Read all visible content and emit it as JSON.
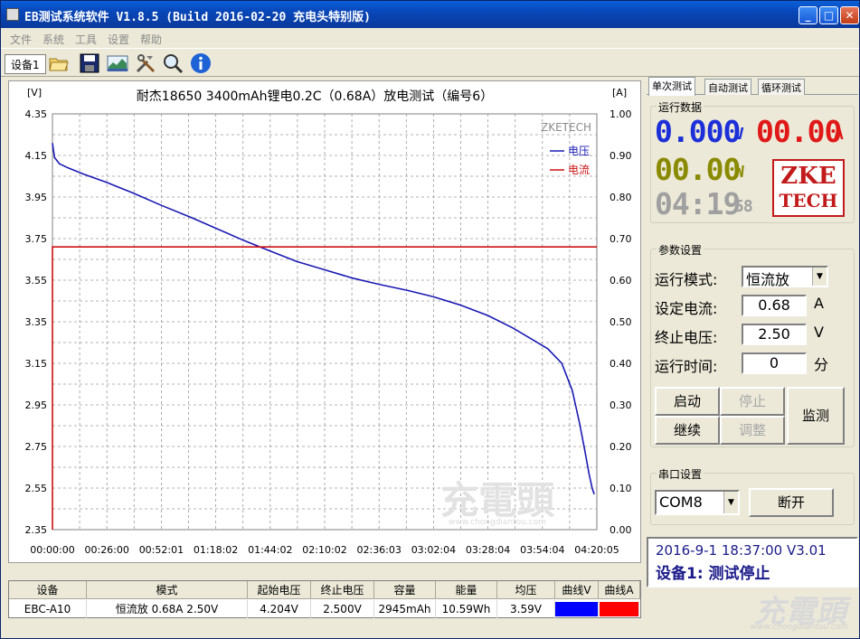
{
  "window": {
    "title": "EB测试系统软件 V1.8.5 (Build 2016-02-20 充电头特别版)",
    "minimize_glyph": "_",
    "maximize_glyph": "□",
    "close_glyph": "✕"
  },
  "menu": [
    "文件",
    "系统",
    "工具",
    "设置",
    "帮助"
  ],
  "toolbar": {
    "device_tab": "设备1",
    "icons": [
      "open-folder-icon",
      "save-icon",
      "chart-image-icon",
      "tools-icon",
      "zoom-icon",
      "info-icon"
    ]
  },
  "chart_data": {
    "type": "line",
    "title": "耐杰18650 3400mAh锂电0.2C（0.68A）放电测试（编号6）",
    "left_unit": "[V]",
    "right_unit": "[A]",
    "watermark_brand": "ZKETECH",
    "left_ticks": [
      "4.35",
      "4.15",
      "3.95",
      "3.75",
      "3.55",
      "3.35",
      "3.15",
      "2.95",
      "2.75",
      "2.55",
      "2.35"
    ],
    "right_ticks": [
      "1.00",
      "0.90",
      "0.80",
      "0.70",
      "0.60",
      "0.50",
      "0.40",
      "0.30",
      "0.20",
      "0.10",
      "0.00"
    ],
    "x_ticks": [
      "00:00:00",
      "00:26:00",
      "00:52:01",
      "01:18:02",
      "01:44:02",
      "02:10:02",
      "02:36:03",
      "03:02:04",
      "03:28:04",
      "03:54:04",
      "04:20:05"
    ],
    "ylim_left": [
      2.35,
      4.35
    ],
    "ylim_right": [
      0.0,
      1.0
    ],
    "xlim_seconds": [
      0,
      15605
    ],
    "grid": true,
    "legend": "top-right",
    "series": [
      {
        "name": "电压",
        "axis": "left",
        "color": "#1a1ab4",
        "points": [
          [
            0,
            4.21
          ],
          [
            60,
            4.14
          ],
          [
            200,
            4.11
          ],
          [
            450,
            4.09
          ],
          [
            900,
            4.06
          ],
          [
            1560,
            4.02
          ],
          [
            2300,
            3.97
          ],
          [
            3121,
            3.91
          ],
          [
            4000,
            3.85
          ],
          [
            4681,
            3.8
          ],
          [
            5500,
            3.74
          ],
          [
            6242,
            3.69
          ],
          [
            7000,
            3.64
          ],
          [
            7802,
            3.6
          ],
          [
            8600,
            3.56
          ],
          [
            9363,
            3.53
          ],
          [
            10200,
            3.5
          ],
          [
            10923,
            3.47
          ],
          [
            11700,
            3.43
          ],
          [
            12484,
            3.38
          ],
          [
            13200,
            3.32
          ],
          [
            13800,
            3.26
          ],
          [
            14200,
            3.22
          ],
          [
            14600,
            3.15
          ],
          [
            14900,
            3.02
          ],
          [
            15100,
            2.87
          ],
          [
            15250,
            2.74
          ],
          [
            15380,
            2.62
          ],
          [
            15470,
            2.55
          ],
          [
            15530,
            2.52
          ]
        ]
      },
      {
        "name": "电流",
        "axis": "right",
        "color": "#cc1111",
        "points": [
          [
            0,
            0.0
          ],
          [
            1,
            0.68
          ],
          [
            15605,
            0.68
          ]
        ]
      }
    ]
  },
  "right_panel": {
    "tabs": [
      "单次测试",
      "自动测试",
      "循环测试"
    ],
    "running_data": {
      "label": "运行数据",
      "voltage": "0.000",
      "voltage_unit": "V",
      "current": "00.00",
      "current_unit": "A",
      "power": "00.00",
      "power_unit": "W",
      "time": "04:19",
      "time_sec": "58",
      "logo_line1": "ZKE",
      "logo_line2": "TECH"
    },
    "params": {
      "label": "参数设置",
      "mode_label": "运行模式:",
      "mode_value": "恒流放",
      "current_label": "设定电流:",
      "current_value": "0.68",
      "current_unit": "A",
      "cutoff_label": "终止电压:",
      "cutoff_value": "2.50",
      "cutoff_unit": "V",
      "time_label": "运行时间:",
      "time_value": "0",
      "time_unit": "分"
    },
    "buttons": {
      "start": "启动",
      "stop": "停止",
      "continue": "继续",
      "adjust": "调整",
      "monitor": "监测"
    },
    "serial": {
      "label": "串口设置",
      "port": "COM8",
      "disconnect": "断开"
    }
  },
  "status": {
    "line1": "2016-9-1 18:37:00  V3.01",
    "line2": "设备1: 测试停止"
  },
  "table": {
    "headers": [
      "设备",
      "模式",
      "起始电压",
      "终止电压",
      "容量",
      "能量",
      "均压",
      "曲线V",
      "曲线A"
    ],
    "row": [
      "EBC-A10",
      "恒流放  0.68A  2.50V",
      "4.204V",
      "2.500V",
      "2945mAh",
      "10.59Wh",
      "3.59V"
    ],
    "curve_v_color": "#0000ff",
    "curve_a_color": "#ff0000"
  },
  "watermark": {
    "text": "充電頭",
    "url": "www.chongdiantou.com"
  }
}
